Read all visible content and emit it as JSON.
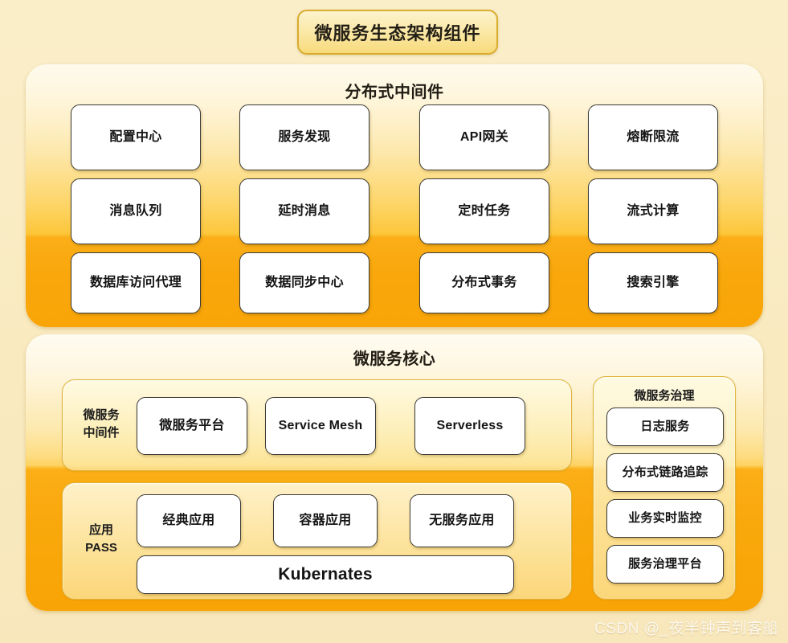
{
  "title": "微服务生态架构组件",
  "watermark": "CSDN @_夜半钟声到客船",
  "colors": {
    "page_background": "#f9ecc5",
    "panel_top": "#fdf4d5",
    "panel_bottom": "#f9a508",
    "title_border": "#d9ac2e",
    "box_border": "#3a3a38",
    "box_fill": "#ffffff",
    "subgroup_border": "#e0b33c"
  },
  "sections": [
    {
      "name": "distributed-middleware",
      "title": "分布式中间件",
      "rows": [
        [
          "配置中心",
          "服务发现",
          "API网关",
          "熔断限流"
        ],
        [
          "消息队列",
          "延时消息",
          "定时任务",
          "流式计算"
        ],
        [
          "数据库访问代理",
          "数据同步中心",
          "分布式事务",
          "搜索引擎"
        ]
      ]
    },
    {
      "name": "microservice-core",
      "title": "微服务核心",
      "groups": [
        {
          "name": "microservice-middleware",
          "label": "微服务\n中间件",
          "label_line1": "微服务",
          "label_line2": "中间件",
          "items": [
            "微服务平台",
            "Service Mesh",
            "Serverless"
          ]
        },
        {
          "name": "application-paas",
          "label_line1": "应用",
          "label_line2": "PASS",
          "items": [
            "经典应用",
            "容器应用",
            "无服务应用"
          ],
          "wide_item": "Kubernates"
        },
        {
          "name": "microservice-governance",
          "title": "微服务治理",
          "items": [
            "日志服务",
            "分布式链路追踪",
            "业务实时监控",
            "服务治理平台"
          ]
        }
      ]
    }
  ]
}
